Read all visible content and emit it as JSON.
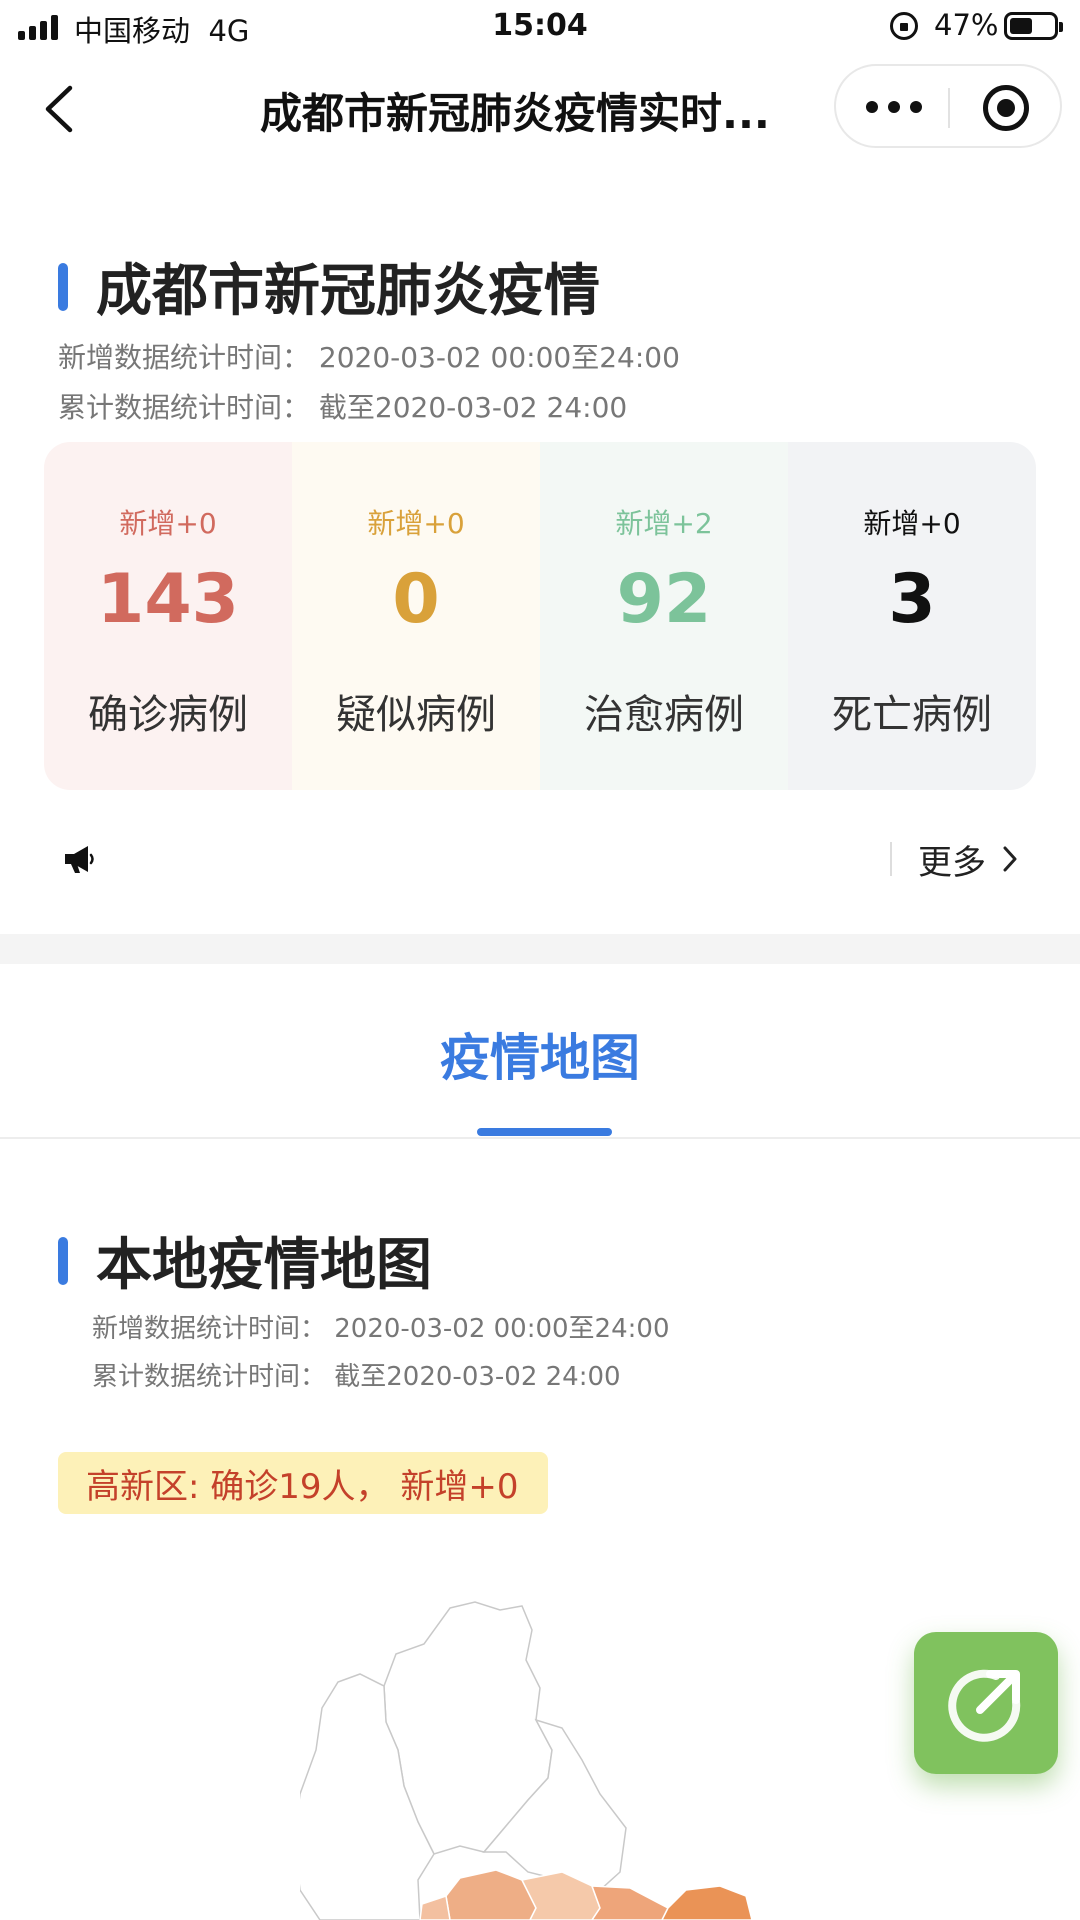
{
  "status_bar": {
    "carrier": "中国移动",
    "network": "4G",
    "time": "15:04",
    "battery": "47%"
  },
  "nav": {
    "title": "成都市新冠肺炎疫情实时...",
    "icons": [
      "back-arrow-icon",
      "more-dots-icon",
      "target-icon"
    ]
  },
  "summary": {
    "heading": "成都市新冠肺炎疫情",
    "new_stats_time": "新增数据统计时间：  2020-03-02  00:00至24:00",
    "total_stats_time": "累计数据统计时间：  截至2020-03-02  24:00",
    "stats": [
      {
        "delta": "新增+0",
        "value": "143",
        "label": "确诊病例",
        "color": "#d16a5e",
        "bg": "#fcf2f1"
      },
      {
        "delta": "新增+0",
        "value": "0",
        "label": "疑似病例",
        "color": "#d9a13a",
        "bg": "#fefaf2"
      },
      {
        "delta": "新增+2",
        "value": "92",
        "label": "治愈病例",
        "color": "#7cc39a",
        "bg": "#f3f8f5"
      },
      {
        "delta": "新增+0",
        "value": "3",
        "label": "死亡病例",
        "color": "#111111",
        "bg": "#f2f3f5"
      }
    ],
    "more_label": "更多"
  },
  "tab": {
    "label": "疫情地图",
    "accent": "#3a7be0"
  },
  "local_map": {
    "heading": "本地疫情地图",
    "new_stats_time": "新增数据统计时间：  2020-03-02  00:00至24:00",
    "total_stats_time": "累计数据统计时间：  截至2020-03-02  24:00",
    "district_tooltip": "高新区: 确诊19人，  新增+0"
  },
  "share_button": {
    "icon": "share-icon",
    "color": "#80c25e"
  }
}
